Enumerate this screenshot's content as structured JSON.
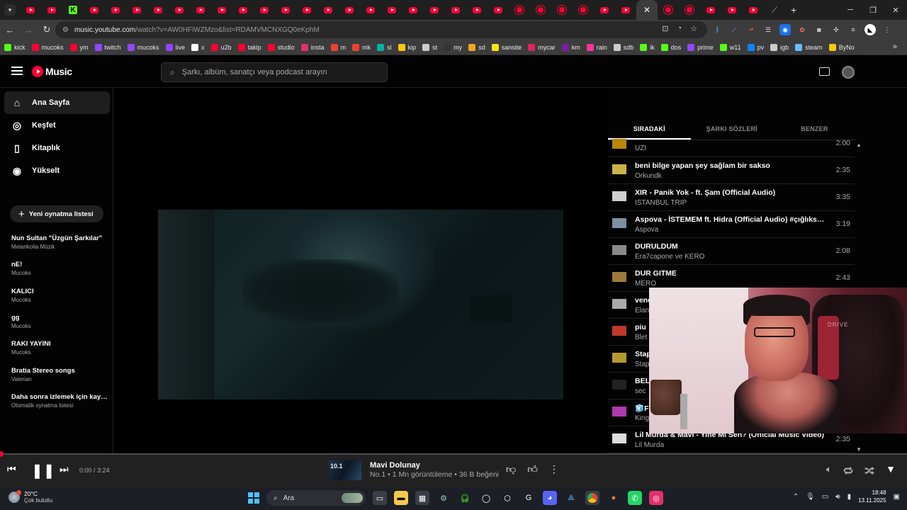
{
  "browser": {
    "url_host": "music.youtube.com",
    "url_path": "/watch?v=AW0HFiWZMzo&list=RDAMVMCNXGQ0eKphM",
    "bookmarks": [
      {
        "label": "kick",
        "color": "#53fc18"
      },
      {
        "label": "mucoks",
        "color": "#ff0033"
      },
      {
        "label": "ym",
        "color": "#ff0033"
      },
      {
        "label": "twitch",
        "color": "#9146ff"
      },
      {
        "label": "mucoks",
        "color": "#9146ff"
      },
      {
        "label": "live",
        "color": "#9146ff"
      },
      {
        "label": "x",
        "color": "#ffffff"
      },
      {
        "label": "u2b",
        "color": "#ff0033"
      },
      {
        "label": "takip",
        "color": "#ff0033"
      },
      {
        "label": "studio",
        "color": "#ff0033"
      },
      {
        "label": "insta",
        "color": "#e1306c"
      },
      {
        "label": "m",
        "color": "#ea4335"
      },
      {
        "label": "mk",
        "color": "#ea4335"
      },
      {
        "label": "sl",
        "color": "#00b3a4"
      },
      {
        "label": "kip",
        "color": "#f6c90e"
      },
      {
        "label": "st",
        "color": "#cccccc"
      },
      {
        "label": "my",
        "color": "#333333"
      },
      {
        "label": "sd",
        "color": "#f4a522"
      },
      {
        "label": "sansite",
        "color": "#f6e21a"
      },
      {
        "label": "mycar",
        "color": "#e0245e"
      },
      {
        "label": "km",
        "color": "#7a1fa2"
      },
      {
        "label": "rain",
        "color": "#ff3399"
      },
      {
        "label": "sdb",
        "color": "#cccccc"
      },
      {
        "label": "ik",
        "color": "#53fc18"
      },
      {
        "label": "dos",
        "color": "#53fc18"
      },
      {
        "label": "prime",
        "color": "#9146ff"
      },
      {
        "label": "w11",
        "color": "#53fc18"
      },
      {
        "label": "pv",
        "color": "#0a84ff"
      },
      {
        "label": "igb",
        "color": "#cccccc"
      },
      {
        "label": "steam",
        "color": "#66c0f4"
      },
      {
        "label": "ByNo",
        "color": "#f6c90e"
      }
    ]
  },
  "header": {
    "logo_text": "Music",
    "search_placeholder": "Şarkı, albüm, sanatçı veya podcast arayın"
  },
  "sidebar": {
    "nav": [
      {
        "label": "Ana Sayfa",
        "icon": "home-icon",
        "glyph": "⌂",
        "active": true
      },
      {
        "label": "Keşfet",
        "icon": "compass-icon",
        "glyph": "◎",
        "active": false
      },
      {
        "label": "Kitaplık",
        "icon": "bookmark-icon",
        "glyph": "▯",
        "active": false
      },
      {
        "label": "Yükselt",
        "icon": "upgrade-icon",
        "glyph": "◉",
        "active": false
      }
    ],
    "new_playlist_label": "Yeni oynatma listesi",
    "playlists": [
      {
        "title": "Nun Sultan \"Üzgün Şarkılar\"",
        "subtitle": "Melankolia Müzik"
      },
      {
        "title": "nE!",
        "subtitle": "Mucoks"
      },
      {
        "title": "KALICI",
        "subtitle": "Mucoks"
      },
      {
        "title": "gg",
        "subtitle": "Mucoks"
      },
      {
        "title": "RAKI YAYINI",
        "subtitle": "Mucoks"
      },
      {
        "title": "Bratia Stereo songs",
        "subtitle": "Valerian"
      },
      {
        "title": "Daha sonra izlemek için kayd...",
        "subtitle": "Otomatik oynatma listesi"
      }
    ]
  },
  "queue": {
    "tabs": [
      {
        "label": "SIRADAKİ",
        "active": true
      },
      {
        "label": "ŞARKI SÖZLERİ",
        "active": false
      },
      {
        "label": "BENZER",
        "active": false
      }
    ],
    "items": [
      {
        "title": "",
        "artist": "UZI",
        "duration": "2:00",
        "thumb": "#b8860b"
      },
      {
        "title": "beni bilge yapan şey sağlam bir sakso",
        "artist": "Orkundk",
        "duration": "2:35",
        "thumb": "#c9b24a"
      },
      {
        "title": "XIR - Panik Yok - ft. Şam (Official Audio)",
        "artist": "ISTANBUL TRIP",
        "duration": "3:35",
        "thumb": "#cfcfcf"
      },
      {
        "title": "Aspova - İSTEMEM ft. Hidra (Official Audio) #çığlıksen...",
        "artist": "Aspova",
        "duration": "3:19",
        "thumb": "#7d8fa0"
      },
      {
        "title": "DURULDUM",
        "artist": "Era7capone ve KERO",
        "duration": "2:08",
        "thumb": "#8a8a8a"
      },
      {
        "title": "DUR GITME",
        "artist": "MERO",
        "duration": "2:43",
        "thumb": "#9c7b3a"
      },
      {
        "title": "vene",
        "artist": "Elan",
        "duration": "",
        "thumb": "#aaaaaa"
      },
      {
        "title": "piu",
        "artist": "Blet",
        "duration": "",
        "thumb": "#c0392b"
      },
      {
        "title": "Stap",
        "artist": "Stap",
        "duration": "",
        "thumb": "#b59a2a"
      },
      {
        "title": "BEL",
        "artist": "sec",
        "duration": "",
        "thumb": "#222222"
      },
      {
        "title": "🧊F",
        "artist": "King",
        "duration": "",
        "thumb": "#b03ab0"
      },
      {
        "title": "Lil Murda & Mavi - Yine Mi Sen? (Official Music Video)",
        "artist": "Lil Murda",
        "duration": "2:35",
        "thumb": "#dddddd"
      }
    ]
  },
  "player": {
    "time": "0:00 / 3:24",
    "progress": 0.0,
    "np_title": "Mavi Dolunay",
    "np_sub": "No.1 • 1 Mn görüntüleme • 36 B beğeni",
    "thumb_text": "10.1"
  },
  "taskbar": {
    "temperature": "20°C",
    "weather": "Çok bulutlu",
    "search_label": "Ara",
    "time": "18:48",
    "date": "13.11.2025"
  },
  "webcam": {
    "chair_text": "DRIVE"
  },
  "colors": {
    "accent": "#ff0033",
    "background": "#030303"
  }
}
